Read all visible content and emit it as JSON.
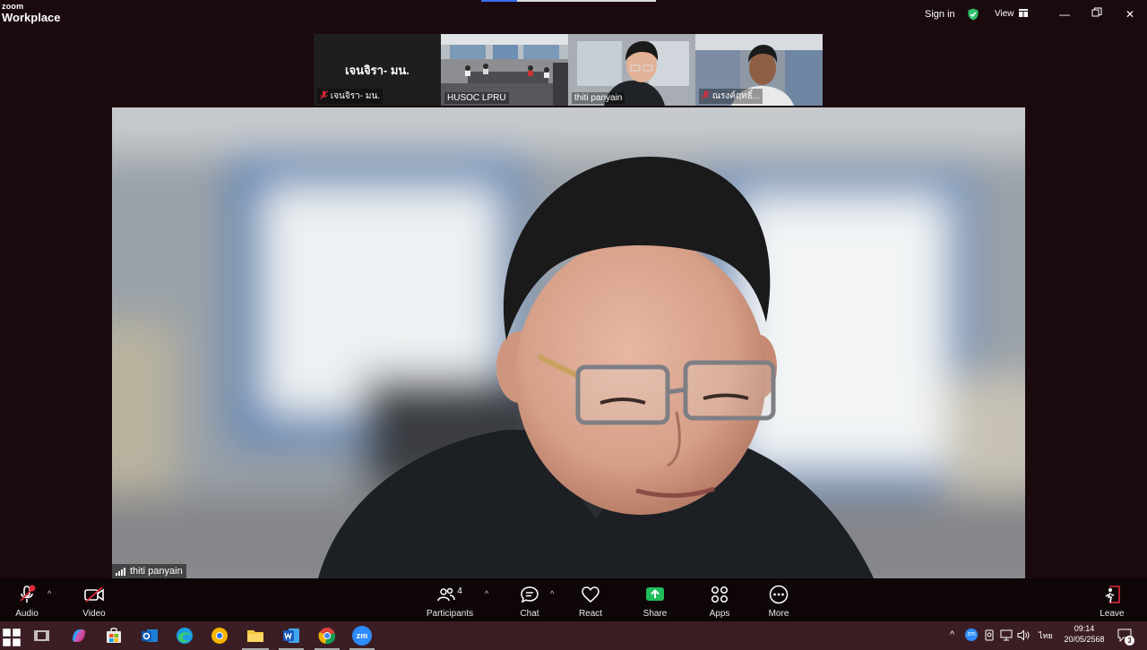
{
  "app": {
    "logo_small": "zoom",
    "logo_big": "Workplace",
    "sign_in": "Sign in",
    "view": "View"
  },
  "thumbnails": [
    {
      "name": "เจนจิรา- มน.",
      "display_text": "เจนจิรา- มน.",
      "muted": true
    },
    {
      "name": "HUSOC LPRU",
      "muted": false
    },
    {
      "name": "thiti panyain",
      "muted": false,
      "active": true
    },
    {
      "name": "ณรงค์ฤทธิ์...",
      "muted": true
    }
  ],
  "main_video": {
    "name": "thiti panyain"
  },
  "controls": {
    "audio": "Audio",
    "video": "Video",
    "participants": "Participants",
    "participants_count": "4",
    "chat": "Chat",
    "react": "React",
    "share": "Share",
    "apps": "Apps",
    "more": "More",
    "leave": "Leave"
  },
  "taskbar": {
    "language": "ไทย",
    "time": "09:14",
    "date": "20/05/2568",
    "notifications": "3",
    "zoom_label": "zm"
  },
  "colors": {
    "active_speaker": "#2dc26b",
    "share_green": "#1fbd5a",
    "mute_red": "#e02a3c",
    "leave_red": "#e02a3c"
  }
}
